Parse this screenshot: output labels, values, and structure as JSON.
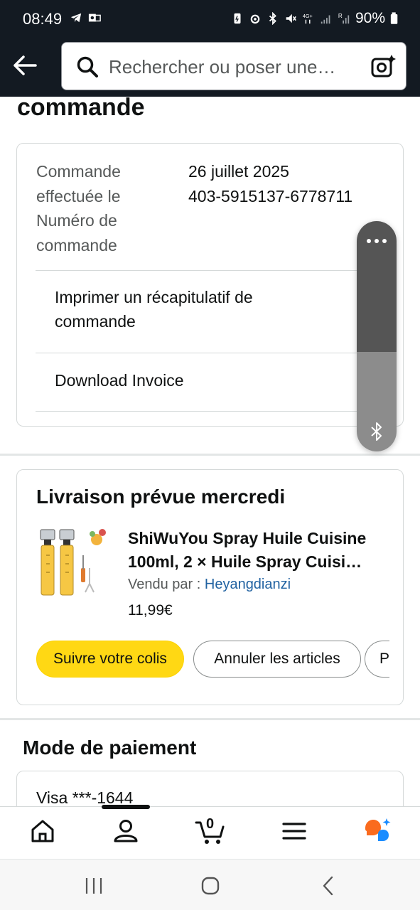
{
  "status_bar": {
    "time": "08:49",
    "battery_percent": "90%"
  },
  "search": {
    "placeholder": "Rechercher ou poser une…"
  },
  "page": {
    "heading": "commande"
  },
  "order_details": {
    "labels": [
      "Commande",
      "effectuée le",
      "Numéro de",
      "commande"
    ],
    "date": "26 juillet 2025",
    "order_number": "403-5915137-6778711",
    "print_summary_lines": [
      "Imprimer un récapitulatif de",
      "commande"
    ],
    "download_invoice": "Download Invoice"
  },
  "shipment": {
    "title": "Livraison prévue mercredi",
    "product_title_lines": [
      "ShiWuYou Spray Huile Cuisine",
      "100ml, 2 × Huile Spray Cuisi…"
    ],
    "seller_label": "Vendu par",
    "seller_separator": " : ",
    "seller_name": "Heyangdianzi",
    "price": "11,99€",
    "actions": {
      "track": "Suivre votre colis",
      "cancel": "Annuler les articles",
      "more": "Po"
    }
  },
  "payment": {
    "heading": "Mode de paiement",
    "card": "Visa ***-1644"
  },
  "bottom_nav": {
    "cart_count": "0",
    "active_tab": "profile"
  },
  "colors": {
    "header_bg": "#131a22",
    "primary_button": "#ffd814",
    "link": "#2162a1",
    "floating_panel_top": "#555555",
    "floating_panel_bottom": "#8c8c8c"
  },
  "icons": [
    "back-arrow-icon",
    "search-icon",
    "camera-search-icon",
    "home-icon",
    "profile-icon",
    "cart-icon",
    "menu-icon",
    "rufus-assistant-icon",
    "more-dots-icon",
    "bluetooth-icon"
  ]
}
